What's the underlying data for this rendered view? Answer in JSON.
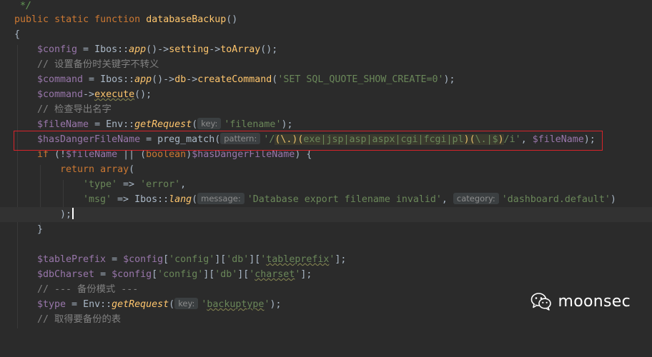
{
  "editor": {
    "language": "php",
    "colors": {
      "background": "#2b2b2b",
      "current_line": "#323232",
      "keyword": "#cc7832",
      "function": "#ffc66d",
      "variable": "#9876aa",
      "string": "#6a8759",
      "comment": "#808080",
      "highlight_box": "#d8242a"
    },
    "tokens": {
      "doc_end": "*/",
      "kw_public": "public",
      "kw_static": "static",
      "kw_function": "function",
      "fn_name": "databaseBackup",
      "open_brace": "{",
      "close_brace": "}",
      "var_config": "$config",
      "var_command": "$command",
      "var_filename": "$fileName",
      "var_hasdanger": "$hasDangerFileName",
      "var_tableprefix": "$tablePrefix",
      "var_dbcharset": "$dbCharset",
      "var_type": "$type",
      "cls_ibos": "Ibos",
      "cls_env": "Env",
      "m_app": "app",
      "m_setting": "setting",
      "m_toarray": "toArray",
      "m_db": "db",
      "m_createcommand": "createCommand",
      "m_execute": "execute",
      "m_getrequest": "getRequest",
      "m_lang": "lang",
      "fn_preg_match": "preg_match",
      "kw_if": "if",
      "kw_boolean": "boolean",
      "kw_return": "return",
      "kw_array": "array",
      "s_sql": "'SET SQL_QUOTE_SHOW_CREATE=0'",
      "s_filename": "'filename'",
      "s_type": "'type'",
      "s_error": "'error'",
      "s_msg": "'msg'",
      "s_db_invalid": "'Database export filename invalid'",
      "s_dash_default": "'dashboard.default'",
      "s_config": "'config'",
      "s_db": "'db'",
      "s_tableprefix_q": "'",
      "s_tableprefix_w": "tableprefix",
      "s_charset_q": "'",
      "s_charset_w": "charset",
      "s_backuptype_w": "backuptype",
      "rx_open": "'/",
      "rx_g1": "(\\.)",
      "rx_g2_open": "(",
      "rx_g2_body": "exe|jsp|asp|aspx|cgi|fcgi|pl",
      "rx_g2_close": ")",
      "rx_g3_open": "(",
      "rx_g3_body": "\\.|$",
      "rx_g3_close": ")",
      "rx_close": "/i'",
      "c_line4": "// 设置备份时关键字不转义",
      "c_line7": "// 检查导出名字",
      "c_line19": "// --- 备份模式 ---",
      "c_line21": "// 取得要备份的表"
    },
    "hints": {
      "key": "key:",
      "pattern": "pattern:",
      "message": "message:",
      "category": "category:"
    }
  },
  "watermark": {
    "icon": "wechat-icon",
    "text": "moonsec"
  }
}
